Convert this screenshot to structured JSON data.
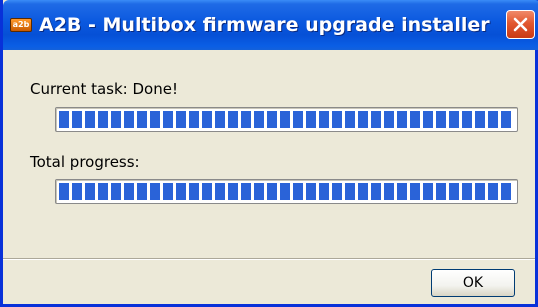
{
  "window": {
    "title": "A2B - Multibox firmware upgrade installer",
    "icon_text": "a2b"
  },
  "task": {
    "label": "Current task: Done!",
    "progress": 1.0
  },
  "total": {
    "label": "Total progress:",
    "progress": 1.0
  },
  "buttons": {
    "ok_label": "OK"
  },
  "colors": {
    "titlebar": "#0a58df",
    "progress_fill": "#2a63d8",
    "close_button": "#e2582f",
    "background": "#ece9d8"
  },
  "icons": {
    "app": "app-icon",
    "close": "close-icon"
  }
}
